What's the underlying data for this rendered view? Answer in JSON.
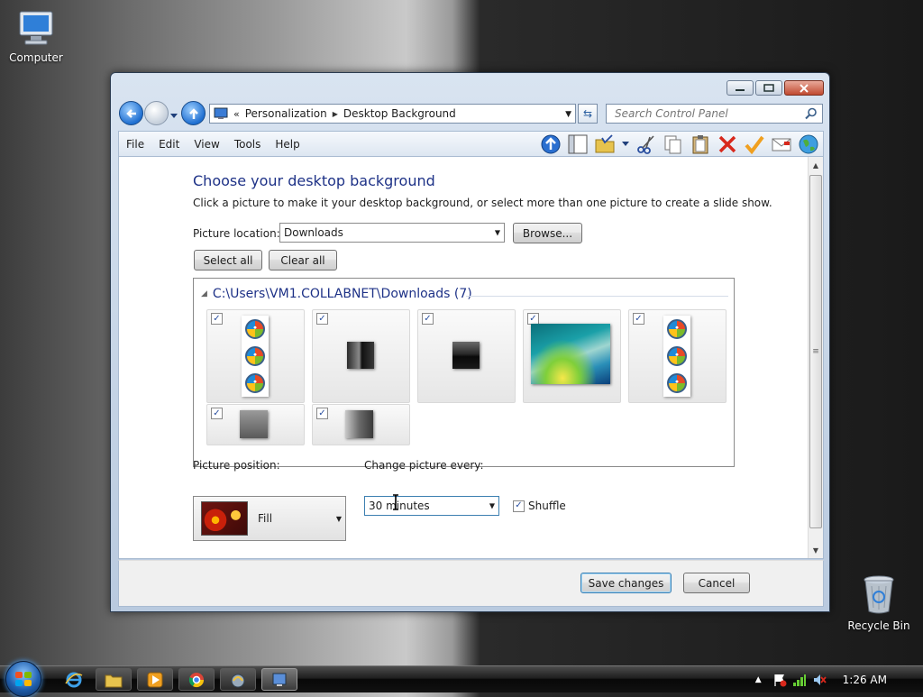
{
  "desktop": {
    "computer_label": "Computer",
    "recycle_label": "Recycle Bin"
  },
  "window": {
    "breadcrumb": [
      "Personalization",
      "Desktop Background"
    ],
    "search_placeholder": "Search Control Panel",
    "menu": [
      "File",
      "Edit",
      "View",
      "Tools",
      "Help"
    ]
  },
  "content": {
    "heading": "Choose your desktop background",
    "description": "Click a picture to make it your desktop background, or select more than one picture to create a slide show.",
    "location_label": "Picture location:",
    "location_value": "Downloads",
    "browse_label": "Browse...",
    "select_all_label": "Select all",
    "clear_all_label": "Clear all",
    "folder_title": "C:\\Users\\VM1.COLLABNET\\Downloads (7)",
    "thumbnails": [
      {
        "kind": "orbs",
        "checked": true
      },
      {
        "kind": "dark-gradient-square",
        "checked": true
      },
      {
        "kind": "dark-square",
        "checked": true
      },
      {
        "kind": "vista-aurora",
        "checked": true
      },
      {
        "kind": "orbs",
        "checked": true
      },
      {
        "kind": "gray-square",
        "checked": true
      },
      {
        "kind": "gray-gradient-square",
        "checked": true
      }
    ],
    "position_label": "Picture position:",
    "position_value": "Fill",
    "change_label": "Change picture every:",
    "change_value": "30 minutes",
    "shuffle_label": "Shuffle",
    "shuffle_checked": true
  },
  "footer": {
    "save_label": "Save changes",
    "cancel_label": "Cancel"
  },
  "taskbar": {
    "clock": "1:26 AM"
  }
}
